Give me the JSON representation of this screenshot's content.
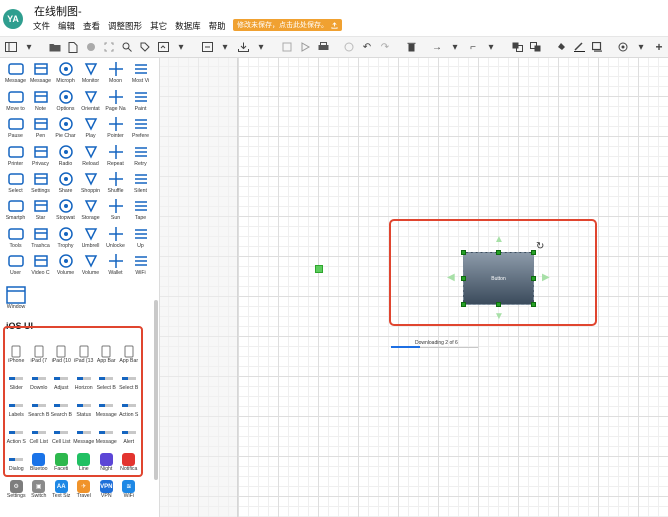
{
  "header": {
    "avatar_initials": "YA",
    "title": "在线制图-",
    "menu": [
      "文件",
      "编辑",
      "查看",
      "调整图形",
      "其它",
      "数据库",
      "帮助"
    ],
    "save_warning": "修改未保存，点击此处保存。"
  },
  "sidebar": {
    "shape_rows": [
      [
        "Message",
        "Message",
        "Microph",
        "Monitor",
        "Moon",
        "Most Vi"
      ],
      [
        "Move to",
        "Note",
        "Options",
        "Orientat",
        "Page Na",
        "Paint"
      ],
      [
        "Pause",
        "Pen",
        "Pie Char",
        "Play",
        "Pointer",
        "Prefere"
      ],
      [
        "Printer",
        "Privacy",
        "Radio",
        "Reload",
        "Repeat",
        "Retry"
      ],
      [
        "Select",
        "Settings",
        "Share",
        "Shoppin",
        "Shuffle",
        "Silent"
      ],
      [
        "Smartph",
        "Star",
        "Stopwat",
        "Storage",
        "Sun",
        "Tape"
      ],
      [
        "Tools",
        "Trashca",
        "Trophy",
        "Umbrell",
        "Unlocke",
        "Up"
      ],
      [
        "User",
        "Video C",
        "Volume",
        "Volume",
        "Wallet",
        "WiFi"
      ]
    ],
    "window_label": "Window",
    "ios_header": "iOS UI",
    "ios_rows": [
      [
        "iPhone",
        "iPad (7",
        "iPad (10",
        "iPad (13",
        "App Bar",
        "App Bar"
      ],
      [
        "Slider",
        "Downlo",
        "Adjust",
        "Horizon",
        "Select B",
        "Select B"
      ],
      [
        "Labels",
        "Search B",
        "Search B",
        "Status",
        "Message",
        "Action S"
      ],
      [
        "Action S",
        "Cell List",
        "Cell List",
        "Message",
        "Message",
        "Alert"
      ],
      [
        "Dialog",
        "Bluetoo",
        "Faceti",
        "Line",
        "Night",
        "Notifica"
      ],
      [
        "Settings",
        "Switch",
        "Text Siz",
        "Travel",
        "VPN",
        "WiFi"
      ]
    ],
    "ios_icon_colors": [
      "#1a73e8",
      "#2db84d",
      "#21c063",
      "#5c46d6",
      "#e3342f"
    ],
    "ios_bottom_icons": [
      {
        "color": "#7d7d7d",
        "glyph": "⚙"
      },
      {
        "color": "#8a8a8a",
        "glyph": "▣"
      },
      {
        "color": "#1e88e5",
        "glyph": "AA"
      },
      {
        "color": "#f0932b",
        "glyph": "✈"
      },
      {
        "color": "#1e6fd9",
        "glyph": "VPN"
      },
      {
        "color": "#1e88e5",
        "glyph": "≋"
      }
    ],
    "small_label": "ß"
  },
  "canvas": {
    "button_label": "Button",
    "download_label": "Downloading 2 of 6",
    "download_progress": 0.33
  }
}
